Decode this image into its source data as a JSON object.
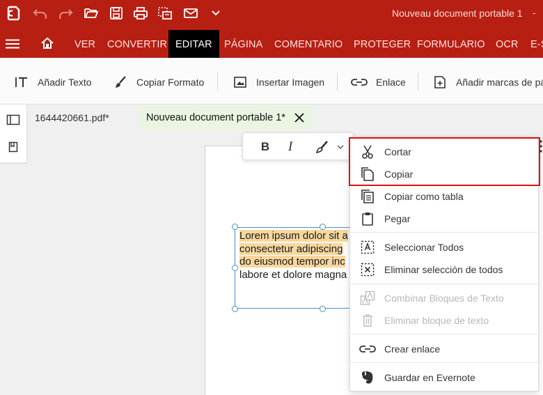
{
  "colors": {
    "brand": "#b81f13",
    "active_tab_bg": "#000000",
    "doc_tab_bg": "#e9f5e0",
    "highlight": "#f7d79d",
    "red_box": "#e01010",
    "selection": "#4a8fc4"
  },
  "titlebar": {
    "icons": [
      "app-logo-icon",
      "undo-icon",
      "redo-icon",
      "open-folder-icon",
      "save-icon",
      "print-icon",
      "scan-icon",
      "mail-icon",
      "chevron-down-icon"
    ],
    "doc_title": "Nouveau document portable 1",
    "minimize": "-"
  },
  "menu": {
    "home_icon": "home-icon",
    "items": [
      "VER",
      "CONVERTIR",
      "EDITAR",
      "PÁGINA",
      "COMENTARIO",
      "PROTEGER",
      "FORMULARIO",
      "OCR",
      "E-S"
    ],
    "active": "EDITAR"
  },
  "toolbar": {
    "add_text": "Añadir Texto",
    "copy_format": "Copiar Formato",
    "insert_image": "Insertar Imagen",
    "link": "Enlace",
    "add_marks": "Añadir marcas de pá"
  },
  "tabs": [
    {
      "label": "1644420661.pdf*"
    },
    {
      "label": "Nouveau document portable 1*"
    }
  ],
  "document": {
    "lines": [
      "Lorem ipsum dolor sit a",
      "consectetur adipiscing",
      "do eiusmod tempor inc",
      "labore et dolore magna"
    ]
  },
  "format_bar": {
    "bold": "B",
    "italic": "I"
  },
  "context_menu": {
    "items": [
      {
        "label": "Cortar",
        "icon": "scissors-icon",
        "enabled": true
      },
      {
        "label": "Copiar",
        "icon": "copy-icon",
        "enabled": true
      },
      {
        "label": "Copiar como tabla",
        "icon": "copy-table-icon",
        "enabled": true
      },
      {
        "label": "Pegar",
        "icon": "paste-icon",
        "enabled": true
      },
      {
        "label": "Seleccionar Todos",
        "icon": "select-all-icon",
        "enabled": true
      },
      {
        "label": "Eliminar selección de todos",
        "icon": "deselect-all-icon",
        "enabled": true
      },
      {
        "label": "Combinar Bloques de Texto",
        "icon": "merge-text-icon",
        "enabled": false
      },
      {
        "label": "Eliminar bloque de texto",
        "icon": "trash-icon",
        "enabled": false
      },
      {
        "label": "Crear enlace",
        "icon": "link-icon",
        "enabled": true
      },
      {
        "label": "Guardar en Evernote",
        "icon": "evernote-icon",
        "enabled": true
      }
    ]
  }
}
